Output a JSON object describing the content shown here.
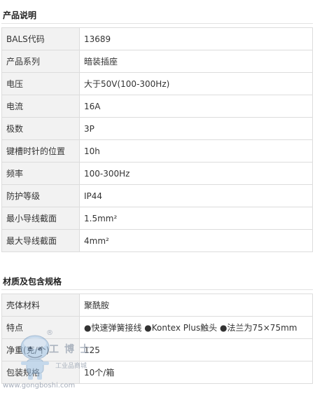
{
  "section1": {
    "title": "产品说明",
    "rows": [
      {
        "key": "BALS代码",
        "value": "13689"
      },
      {
        "key": "产品系列",
        "value": "暗装插座"
      },
      {
        "key": "电压",
        "value": "大于50V(100-300Hz)"
      },
      {
        "key": "电流",
        "value": "16A"
      },
      {
        "key": "极数",
        "value": "3P"
      },
      {
        "key": "键槽时针的位置",
        "value": "10h"
      },
      {
        "key": "频率",
        "value": "100-300Hz"
      },
      {
        "key": "防护等级",
        "value": "IP44"
      },
      {
        "key": "最小导线截面",
        "value": "1.5mm²"
      },
      {
        "key": "最大导线截面",
        "value": "4mm²"
      }
    ]
  },
  "section2": {
    "title": "材质及包含规格",
    "rows": [
      {
        "key": "壳体材料",
        "value": "聚酰胺"
      },
      {
        "key": "特点",
        "value": "●快速弹簧接线 ●Kontex Plus触头 ●法兰为75×75mm"
      },
      {
        "key": "净重(克/个)",
        "value": "125"
      },
      {
        "key": "包装规格",
        "value": "10个/箱"
      }
    ]
  },
  "watermark": {
    "brand": "工博士",
    "sub": "工业品商城",
    "url": "www.gongboshi.com",
    "reg": "®"
  },
  "colors": {
    "key_bg": "#f2f2f2",
    "border": "#dcdcdc"
  }
}
